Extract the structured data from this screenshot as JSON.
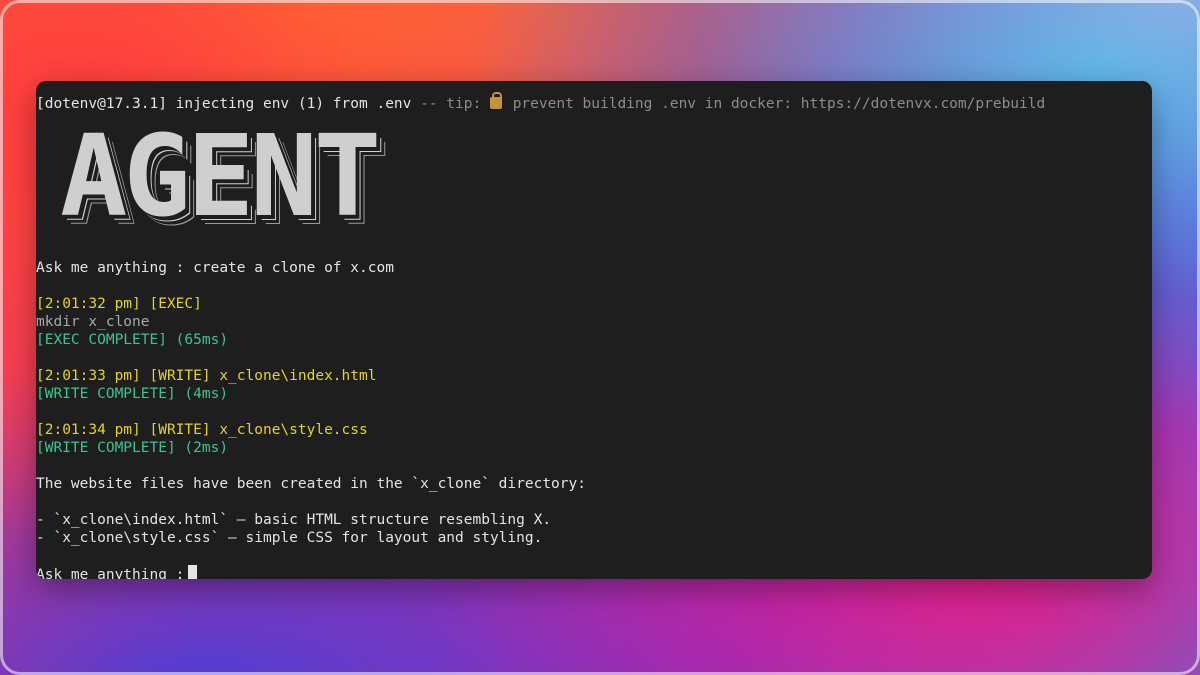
{
  "terminal": {
    "env_notice": {
      "prefix": "[dotenv@17.3.1] injecting env (1) from .env",
      "tip": " -- tip: ",
      "tip_text": " prevent building .env in docker: https://dotenvx.com/prebuild"
    },
    "banner": "AGENT",
    "prompt_1": "Ask me anything : create a clone of x.com",
    "log": [
      {
        "header": "[2:01:32 pm] [EXEC]",
        "body": "mkdir x_clone",
        "result": "[EXEC COMPLETE] (65ms)"
      },
      {
        "header": "[2:01:33 pm] [WRITE] x_clone\\index.html",
        "result": "[WRITE COMPLETE] (4ms)"
      },
      {
        "header": "[2:01:34 pm] [WRITE] x_clone\\style.css",
        "result": "[WRITE COMPLETE] (2ms)"
      }
    ],
    "summary": "The website files have been created in the `x_clone` directory:",
    "bullets": [
      "- `x_clone\\index.html` — basic HTML structure resembling X.",
      "- `x_clone\\style.css` — simple CSS for layout and styling."
    ],
    "prompt_2": "Ask me anything :"
  },
  "colors": {
    "terminal_bg": "#1e1e1e",
    "yellow": "#e5d22a",
    "green": "#3ec48c"
  }
}
